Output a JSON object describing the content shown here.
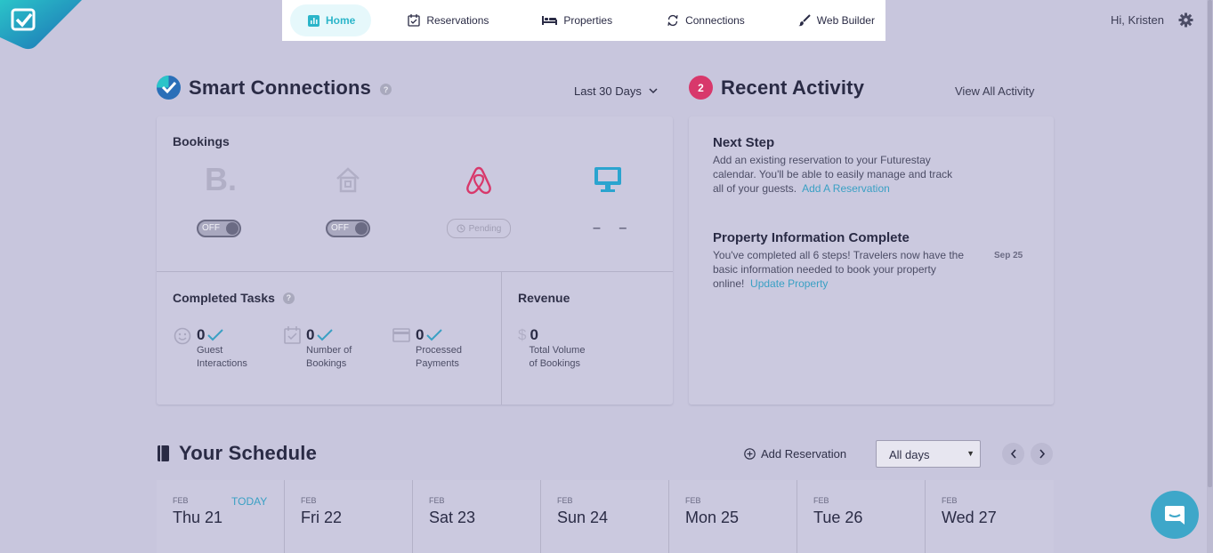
{
  "nav": {
    "items": [
      {
        "label": "Home",
        "icon": "chart-icon",
        "active": true
      },
      {
        "label": "Reservations",
        "icon": "calendar-check-icon"
      },
      {
        "label": "Properties",
        "icon": "bed-icon"
      },
      {
        "label": "Connections",
        "icon": "sync-icon"
      },
      {
        "label": "Web Builder",
        "icon": "brush-icon"
      }
    ],
    "greeting": "Hi, Kristen"
  },
  "smart_connections": {
    "title": "Smart Connections",
    "help": "?",
    "range": "Last 30 Days",
    "bookings": {
      "label": "Bookings",
      "booking_com": {
        "logo_text": "B.",
        "status": "OFF"
      },
      "homeaway": {
        "status": "OFF"
      },
      "airbnb": {
        "status": "Pending"
      },
      "website": {
        "status": "– –"
      }
    },
    "completed_tasks": {
      "label": "Completed Tasks",
      "help": "?",
      "items": [
        {
          "value": "0",
          "line1": "Guest",
          "line2": "Interactions"
        },
        {
          "value": "0",
          "line1": "Number of",
          "line2": "Bookings"
        },
        {
          "value": "0",
          "line1": "Processed",
          "line2": "Payments"
        }
      ]
    },
    "revenue": {
      "label": "Revenue",
      "symbol": "$",
      "value": "0",
      "line1": "Total Volume",
      "line2": "of Bookings"
    }
  },
  "recent_activity": {
    "badge": "2",
    "title": "Recent Activity",
    "view_all": "View All Activity",
    "next_step": {
      "title": "Next Step",
      "line1": "Add an existing reservation to your Futurestay",
      "line2": "calendar. You'll be able to easily manage and track",
      "line3": "all of your guests.",
      "link": "Add A Reservation"
    },
    "property_info": {
      "title": "Property Information Complete",
      "line1": "You've completed all 6 steps! Travelers now have the",
      "line2": "basic information needed to book your property",
      "line3": "online!",
      "link": "Update Property",
      "date": "Sep 25"
    }
  },
  "schedule": {
    "title": "Your Schedule",
    "add_reservation": "Add Reservation",
    "filter": "All days",
    "days": [
      {
        "month": "FEB",
        "day": "Thu 21",
        "today": "TODAY"
      },
      {
        "month": "FEB",
        "day": "Fri 22"
      },
      {
        "month": "FEB",
        "day": "Sat 23"
      },
      {
        "month": "FEB",
        "day": "Sun 24"
      },
      {
        "month": "FEB",
        "day": "Mon 25"
      },
      {
        "month": "FEB",
        "day": "Tue 26"
      },
      {
        "month": "FEB",
        "day": "Wed 27"
      }
    ]
  },
  "colors": {
    "background": "#c8c6dd",
    "accent": "#2bb5c9",
    "link": "#3aa0c4",
    "badge": "#d8386b",
    "airbnb": "#d8386b",
    "chat": "#3ea7c9"
  }
}
